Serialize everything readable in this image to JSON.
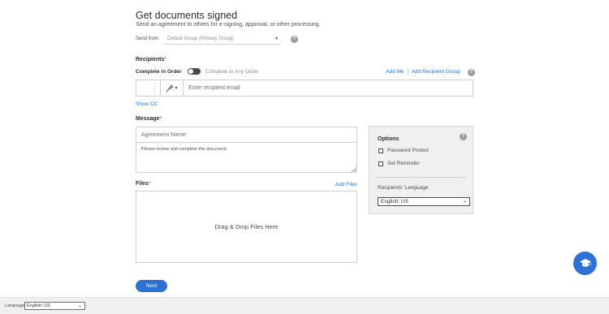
{
  "header": {
    "title": "Get documents signed",
    "subtitle": "Send an agreement to others for e-signing, approval, or other processing."
  },
  "send_from": {
    "label": "Send from:",
    "value": "Default Group (Primary Group)"
  },
  "recipients": {
    "label": "Recipients",
    "required_mark": "*",
    "complete_in_order": "Complete in Order",
    "complete_in_any_order": "Complete in Any Order",
    "add_me": "Add Me",
    "add_recipient_group": "Add Recipient Group",
    "email_placeholder": "Enter recipient email",
    "show_cc": "Show CC"
  },
  "message": {
    "label": "Message",
    "required_mark": "*",
    "agreement_name_placeholder": "Agreement Name",
    "body": "Please review and complete this document."
  },
  "files": {
    "label": "Files",
    "required_mark": "*",
    "add_files": "Add Files",
    "dropzone_text": "Drag & Drop Files Here"
  },
  "options": {
    "title": "Options",
    "password_protect": "Password Protect",
    "set_reminder": "Set Reminder",
    "recipients_language_label": "Recipients' Language",
    "recipients_language_value": "English: US"
  },
  "actions": {
    "next": "Next"
  },
  "footer": {
    "language_label": "Language",
    "language_value": "English: US"
  },
  "icons": {
    "help": "question-mark-circle",
    "signature_role": "pen-nib",
    "education": "graduation-cap"
  },
  "colors": {
    "accent": "#2d72d2",
    "link": "#1473e6",
    "required": "#d7373f"
  }
}
